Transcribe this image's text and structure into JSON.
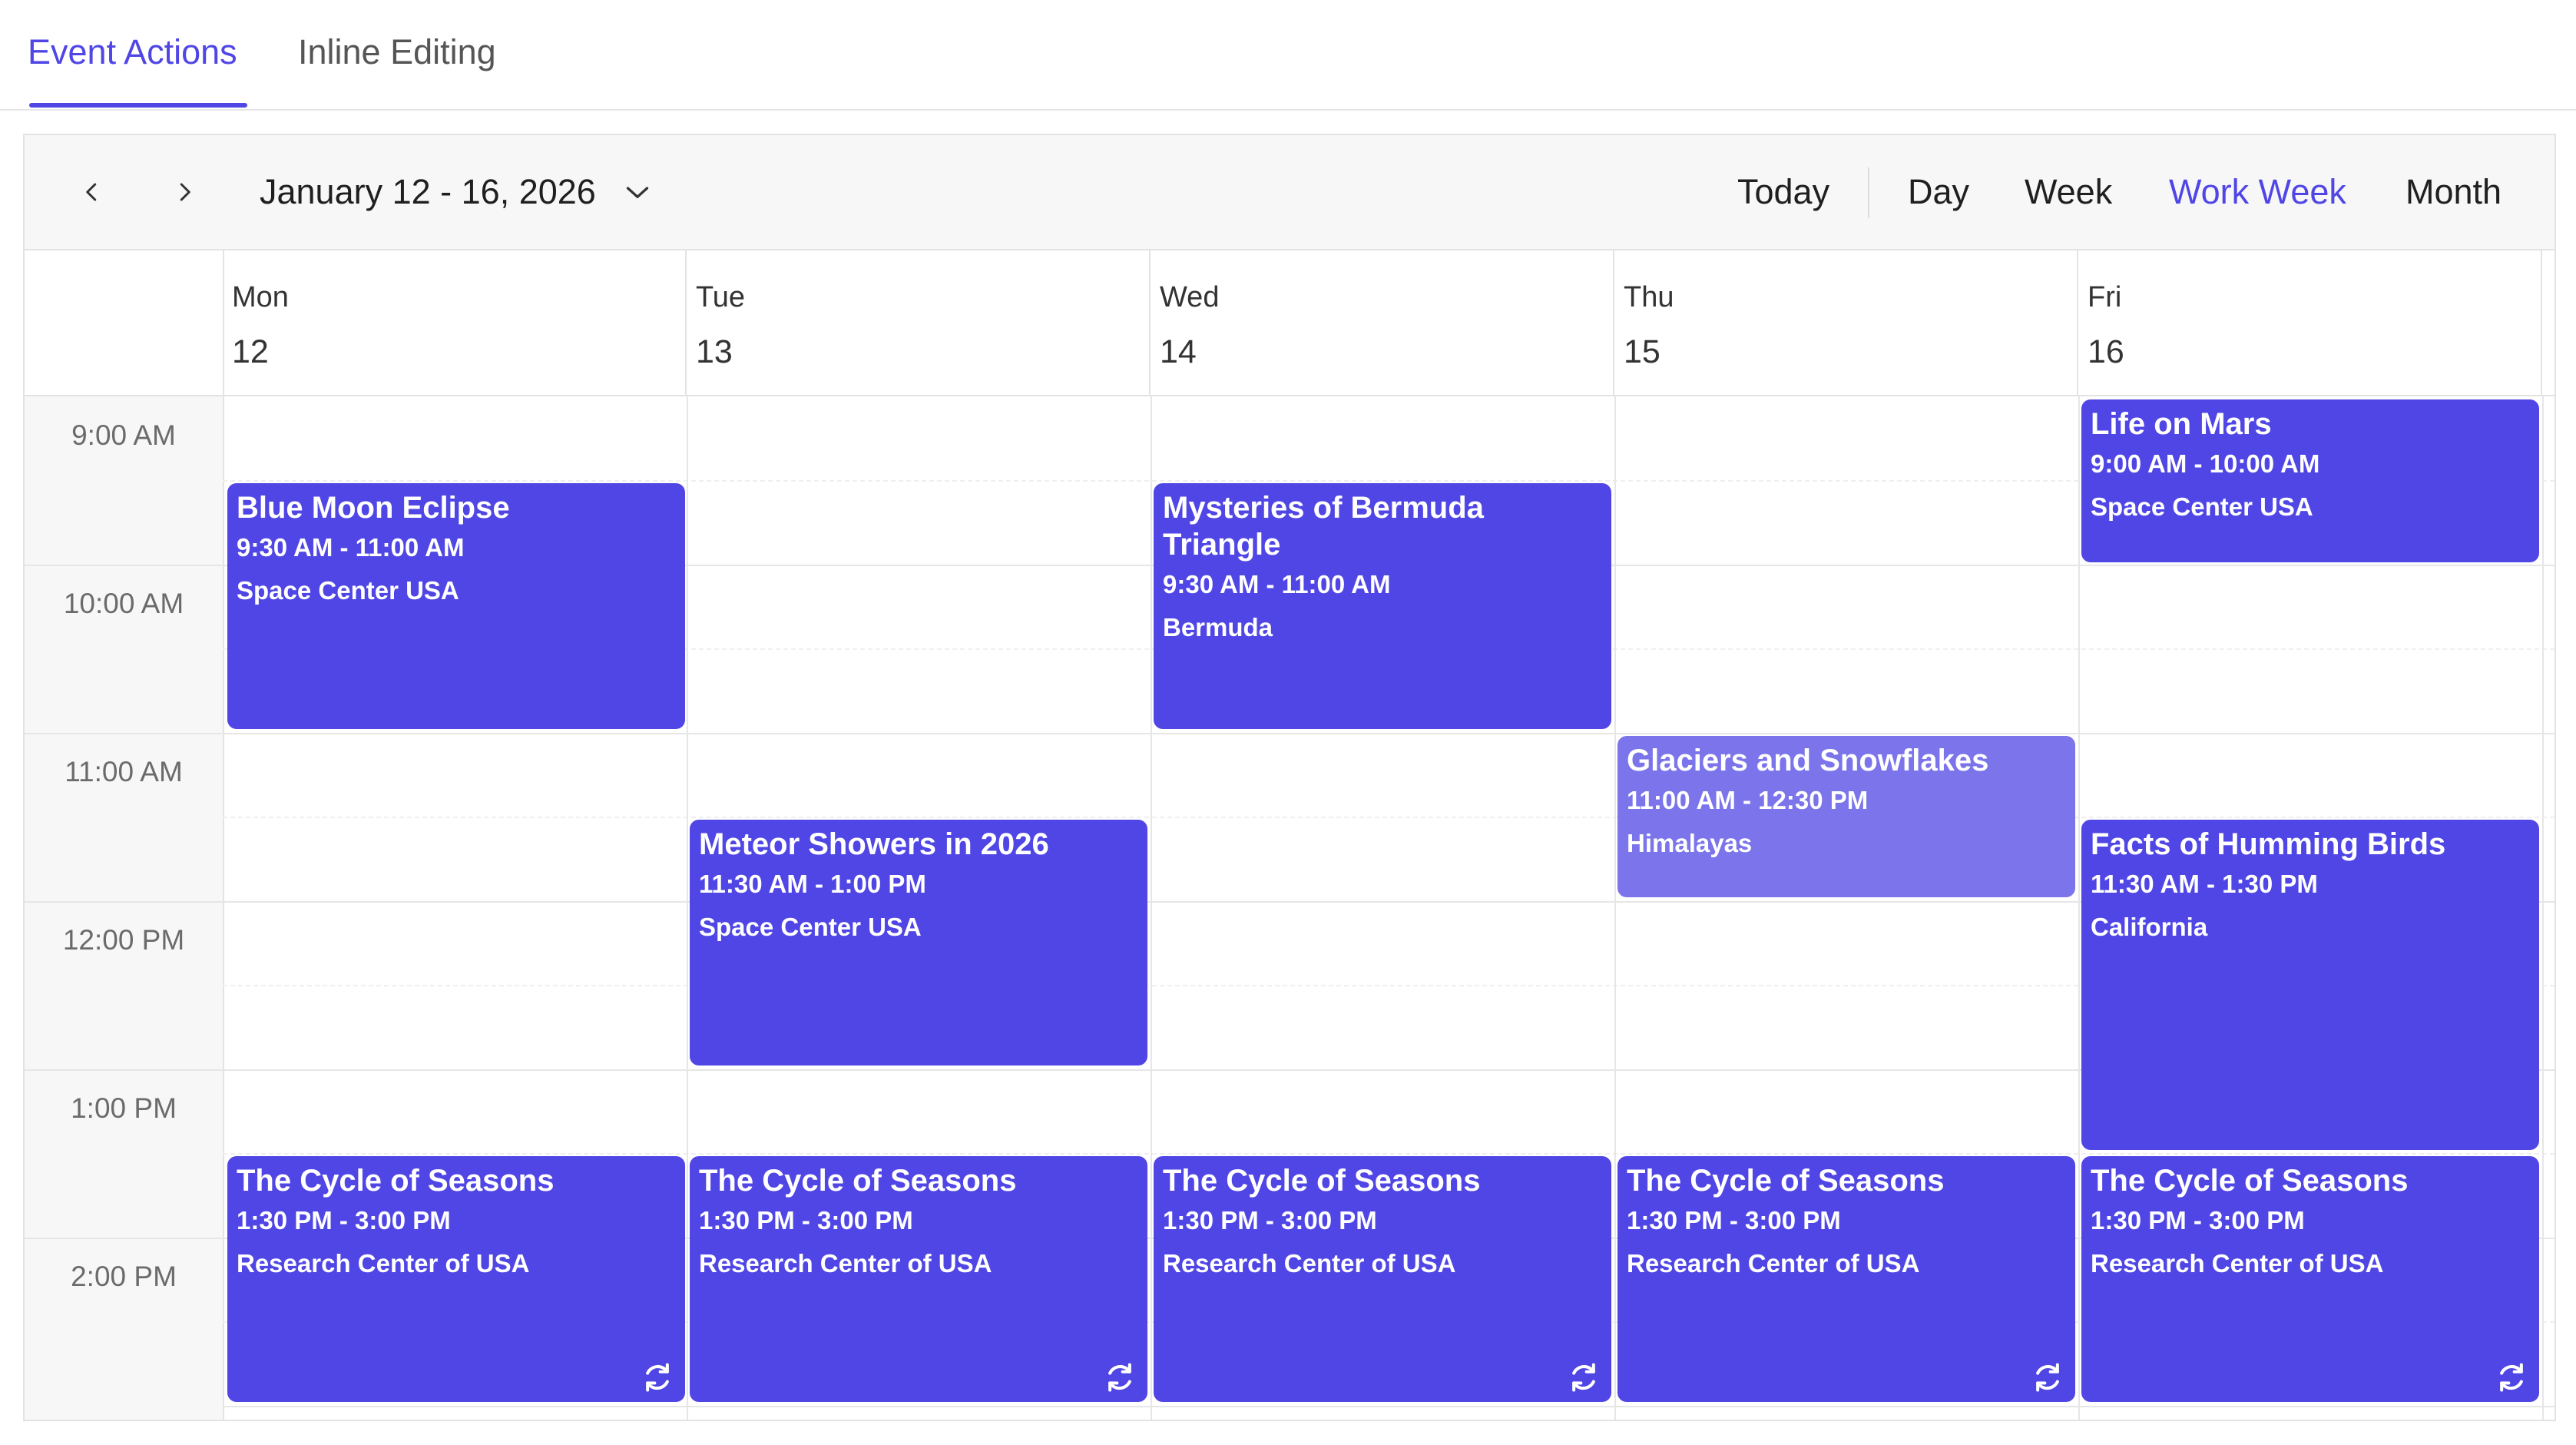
{
  "tabs": [
    {
      "label": "Event Actions",
      "active": true
    },
    {
      "label": "Inline Editing",
      "active": false
    }
  ],
  "toolbar": {
    "date_range": "January 12 - 16, 2026",
    "prev_icon": "chevron-left-icon",
    "next_icon": "chevron-right-icon",
    "today": "Today",
    "views": [
      "Day",
      "Week",
      "Work Week",
      "Month"
    ],
    "active_view": "Work Week"
  },
  "days": [
    {
      "name": "Mon",
      "num": "12"
    },
    {
      "name": "Tue",
      "num": "13"
    },
    {
      "name": "Wed",
      "num": "14"
    },
    {
      "name": "Thu",
      "num": "15"
    },
    {
      "name": "Fri",
      "num": "16"
    }
  ],
  "times": [
    "9:00 AM",
    "10:00 AM",
    "11:00 AM",
    "12:00 PM",
    "1:00 PM",
    "2:00 PM"
  ],
  "events": [
    {
      "title": "Blue Moon Eclipse",
      "time": "9:30 AM - 11:00 AM",
      "location": "Space Center USA"
    },
    {
      "title": "Mysteries of Bermuda Triangle",
      "time": "9:30 AM - 11:00 AM",
      "location": "Bermuda"
    },
    {
      "title": "Life on Mars",
      "time": "9:00 AM - 10:00 AM",
      "location": "Space Center USA"
    },
    {
      "title": "Glaciers and Snowflakes",
      "time": "11:00 AM - 12:30 PM",
      "location": "Himalayas"
    },
    {
      "title": "Meteor Showers in 2026",
      "time": "11:30 AM - 1:00 PM",
      "location": "Space Center USA"
    },
    {
      "title": "Facts of Humming Birds",
      "time": "11:30 AM - 1:30 PM",
      "location": "California"
    },
    {
      "title": "The Cycle of Seasons",
      "time": "1:30 PM - 3:00 PM",
      "location": "Research Center of USA",
      "recurring": true
    },
    {
      "title": "The Cycle of Seasons",
      "time": "1:30 PM - 3:00 PM",
      "location": "Research Center of USA",
      "recurring": true
    },
    {
      "title": "The Cycle of Seasons",
      "time": "1:30 PM - 3:00 PM",
      "location": "Research Center of USA",
      "recurring": true
    },
    {
      "title": "The Cycle of Seasons",
      "time": "1:30 PM - 3:00 PM",
      "location": "Research Center of USA",
      "recurring": true
    },
    {
      "title": "The Cycle of Seasons",
      "time": "1:30 PM - 3:00 PM",
      "location": "Research Center of USA",
      "recurring": true
    }
  ],
  "colors": {
    "accent": "#4f46e5",
    "event": "#4f46e5",
    "event_selected": "#7b74ea"
  }
}
